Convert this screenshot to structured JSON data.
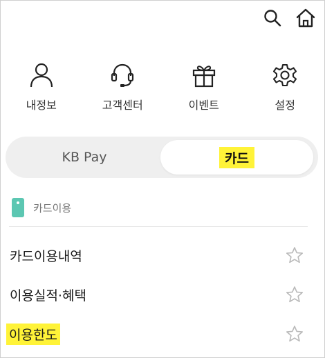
{
  "header": {
    "icons": [
      "search-icon",
      "home-icon"
    ]
  },
  "quick_menu": [
    {
      "label": "내정보",
      "icon": "person-icon"
    },
    {
      "label": "고객센터",
      "icon": "headset-icon"
    },
    {
      "label": "이벤트",
      "icon": "gift-icon"
    },
    {
      "label": "설정",
      "icon": "gear-icon"
    }
  ],
  "segment": {
    "options": [
      "KB Pay",
      "카드"
    ],
    "selected": "카드"
  },
  "section": {
    "title": "카드이용",
    "icon": "card-icon"
  },
  "menu": [
    {
      "label": "카드이용내역",
      "icon": "star-outline-icon"
    },
    {
      "label": "이용실적·혜택",
      "icon": "star-outline-icon"
    },
    {
      "label": "이용한도",
      "icon": "star-outline-icon"
    }
  ],
  "colors": {
    "highlight": "#fff338",
    "card_icon": "#5cc7b2",
    "segment_bg": "#efefef"
  }
}
